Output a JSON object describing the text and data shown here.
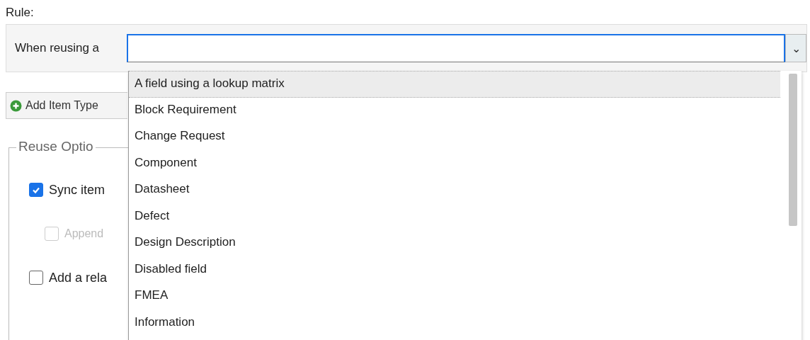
{
  "rule_label": "Rule:",
  "rule": {
    "prefix": "When reusing a",
    "dropdown_button": "⌄"
  },
  "dropdown": {
    "items": [
      {
        "label": "A field using a lookup matrix",
        "selected": true
      },
      {
        "label": "Block Requirement",
        "selected": false
      },
      {
        "label": "Change Request",
        "selected": false
      },
      {
        "label": "Component",
        "selected": false
      },
      {
        "label": "Datasheet",
        "selected": false
      },
      {
        "label": "Defect",
        "selected": false
      },
      {
        "label": "Design Description",
        "selected": false
      },
      {
        "label": "Disabled field",
        "selected": false
      },
      {
        "label": "FMEA",
        "selected": false
      },
      {
        "label": "Information",
        "selected": false
      }
    ]
  },
  "add_button": "Add Item Type",
  "reuse_options": {
    "legend": "Reuse Optio",
    "options": [
      {
        "label": "Sync item",
        "checked": true,
        "disabled": false,
        "children": [
          {
            "label": "Append",
            "checked": false,
            "disabled": true
          }
        ]
      },
      {
        "label": "Add a rela",
        "checked": false,
        "disabled": false
      }
    ]
  }
}
